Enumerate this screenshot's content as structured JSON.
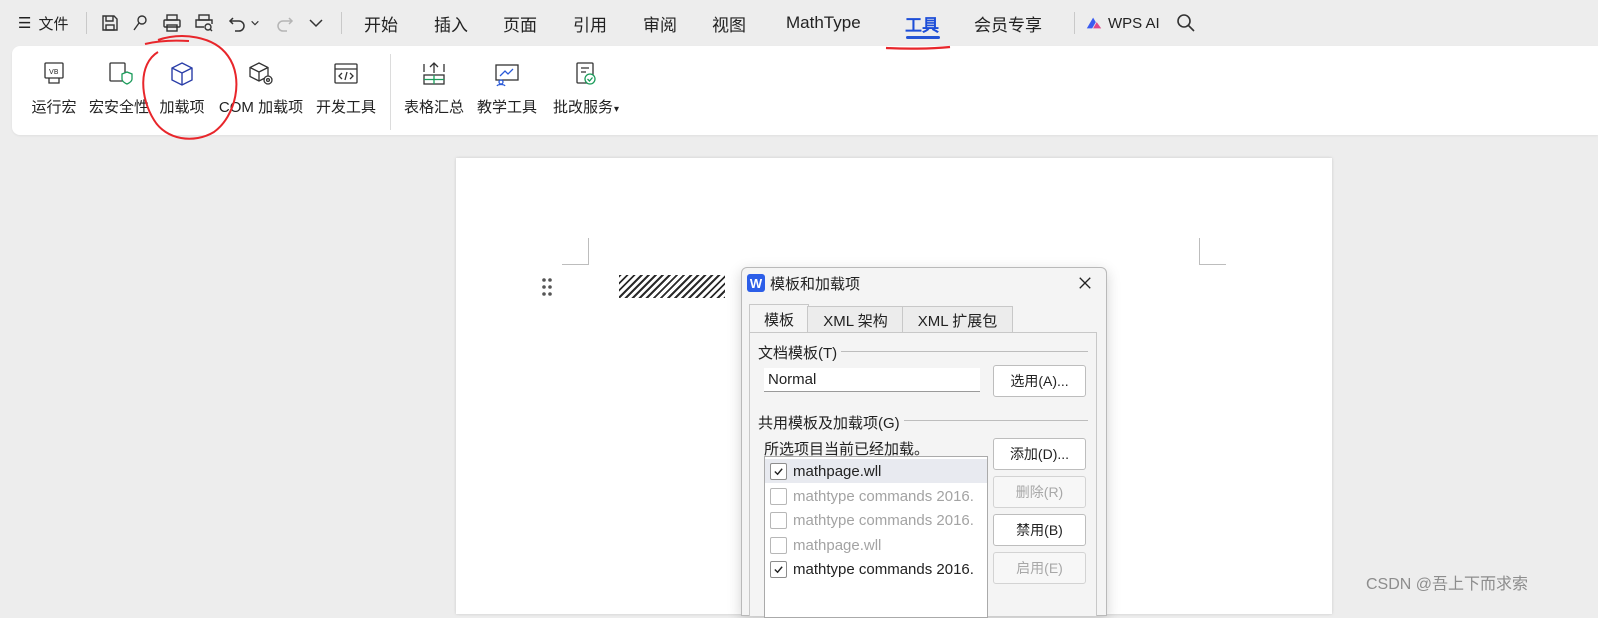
{
  "tabbar": {
    "menu_label": "文件",
    "tabs": [
      "开始",
      "插入",
      "页面",
      "引用",
      "审阅",
      "视图",
      "MathType",
      "工具",
      "会员专享"
    ],
    "active_tab": "工具",
    "ai_label": "WPS AI"
  },
  "ribbon": {
    "buttons": [
      "运行宏",
      "宏安全性",
      "加载项",
      "COM 加载项",
      "开发工具",
      "表格汇总",
      "教学工具",
      "批改服务"
    ],
    "icon_badge": "VB"
  },
  "dialog": {
    "logo": "W",
    "title": "模板和加载项",
    "tabs": [
      "模板",
      "XML 架构",
      "XML 扩展包"
    ],
    "doc_template_label": "文档模板(T)",
    "doc_template_value": "Normal",
    "select_button": "选用(A)...",
    "shared_label": "共用模板及加载项(G)",
    "loaded_note": "所选项目当前已经加载。",
    "add_button": "添加(D)...",
    "delete_button": "删除(R)",
    "disable_button": "禁用(B)",
    "enable_button": "启用(E)",
    "items": [
      {
        "name": "mathpage.wll",
        "checked": true,
        "enabled": true
      },
      {
        "name": "mathtype commands 2016.",
        "checked": false,
        "enabled": false
      },
      {
        "name": "mathtype commands 2016.",
        "checked": false,
        "enabled": false
      },
      {
        "name": "mathpage.wll",
        "checked": false,
        "enabled": false
      },
      {
        "name": "mathtype commands 2016.",
        "checked": true,
        "enabled": true
      }
    ]
  },
  "watermark": "CSDN @吾上下而求索",
  "colors": {
    "accent": "#2454d6",
    "annotation": "#e8262b"
  }
}
